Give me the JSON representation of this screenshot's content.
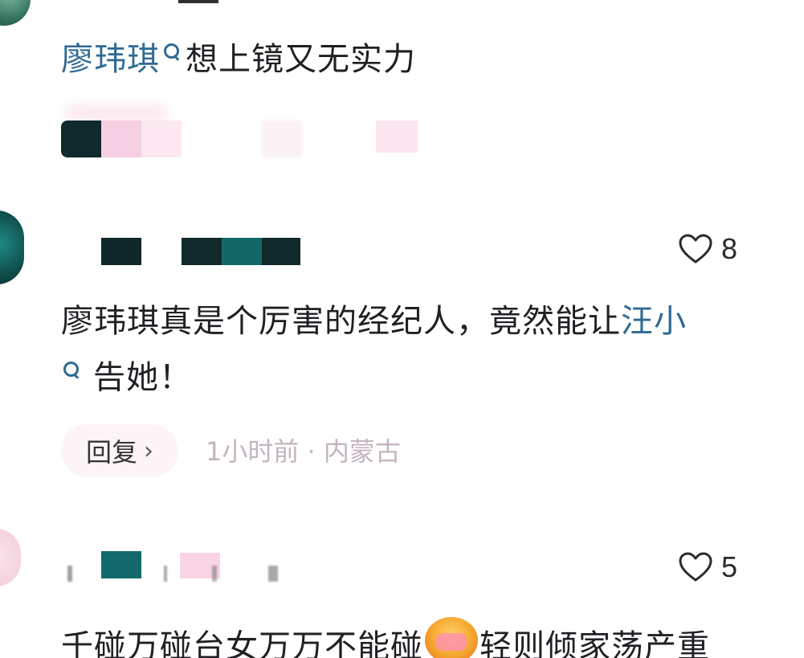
{
  "comments": [
    {
      "avatar_icon": "user-avatar",
      "link_name": "廖玮琪",
      "text": "想上镜又无实力"
    },
    {
      "avatar_icon": "user-avatar",
      "likes": "8",
      "text_before": "廖玮琪真是个厉害的经纪人，竟然能让",
      "link_name": "汪小",
      "text_after": "告她！",
      "reply_label": "回复",
      "time_location": "1小时前 · 内蒙古"
    },
    {
      "avatar_icon": "user-avatar",
      "likes": "5",
      "text_before": "千碰万碰台女万万不能碰",
      "emoji_icon": "facepalm-laugh-emoji",
      "text_after": "轻则倾家荡产重"
    }
  ]
}
